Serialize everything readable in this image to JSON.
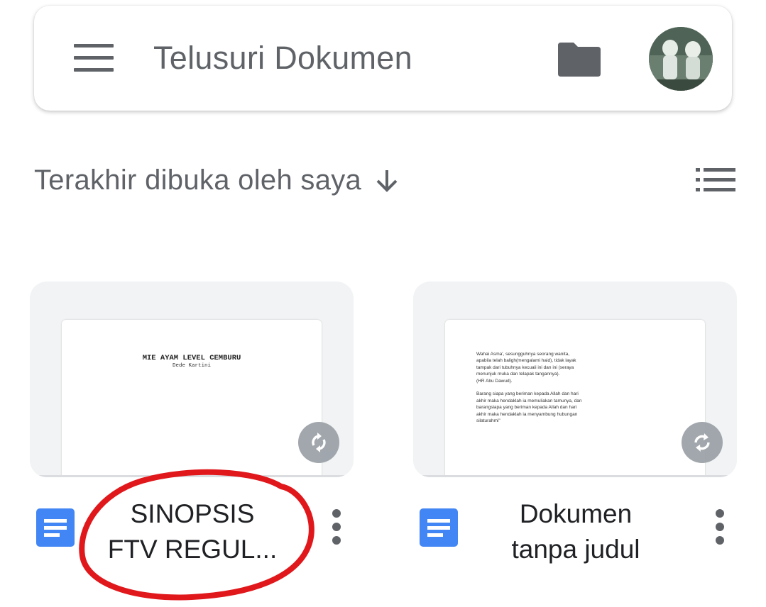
{
  "search": {
    "placeholder": "Telusuri Dokumen",
    "menu_icon": "hamburger-menu-icon",
    "folder_icon": "folder-icon",
    "avatar_icon": "account-avatar"
  },
  "sort": {
    "label": "Terakhir dibuka oleh saya",
    "direction_icon": "arrow-down-icon",
    "view_toggle_icon": "list-view-icon"
  },
  "documents": [
    {
      "name": "SINOPSIS FTV REGUL...",
      "name_lines": [
        "SINOPSIS",
        "FTV REGUL..."
      ],
      "preview_title": "MIE AYAM LEVEL CEMBURU",
      "preview_author": "Dede Kartini",
      "type_icon": "google-docs-icon",
      "sync_icon": "sync-icon",
      "menu_icon": "more-vertical-icon"
    },
    {
      "name": "Dokumen tanpa judul",
      "name_lines": [
        "Dokumen",
        "tanpa judul"
      ],
      "preview_text": "Wahai Asma', sesungguhnya seorang wanita,\napabila telah baligh(mengalami haid), tidak layak\ntampak dari tubuhnya kecuali ini dan ini (seraya\nmenunjuk muka dan telapak tangannya).\n(HR Abu Dawud).\n\nBarang siapa yang beriman kepada Allah dan hari\nakhir maka hendaklah ia memuliakan tamunya, dan\nbarangsiapa yang beriman kepada Allah dan hari\nakhir maka hendaklah ia menyambung hubungan\nsilaturahmi\"",
      "type_icon": "google-docs-icon",
      "sync_icon": "sync-icon",
      "menu_icon": "more-vertical-icon"
    }
  ],
  "colors": {
    "icon_gray": "#5f6368",
    "docs_blue": "#4285f4",
    "card_bg": "#f1f3f4",
    "annotation_red": "#e0181c"
  }
}
